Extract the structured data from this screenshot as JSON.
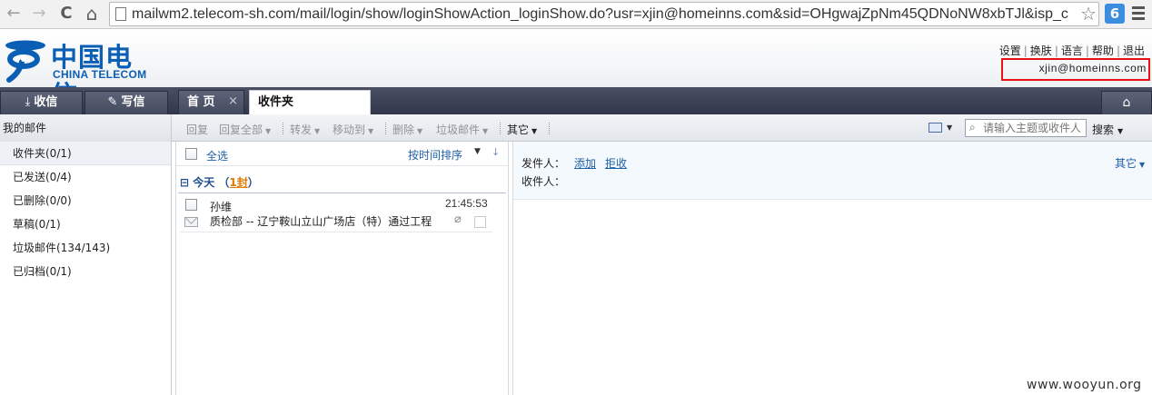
{
  "browser": {
    "back_icon": "←",
    "forward_icon": "→",
    "reload_icon": "C",
    "home_icon": "⌂",
    "url": "mailwm2.telecom-sh.com/mail/login/show/loginShowAction_loginShow.do?usr=xjin@homeinns.com&sid=OHgwajZpNm45QDNoNW8xbTJl&isp_c",
    "bookmark_icon": "☆",
    "extension_label": "6"
  },
  "header": {
    "logo_cn": "中国电信",
    "logo_en": "CHINA TELECOM",
    "links": [
      "设置",
      "换肤",
      "语言",
      "帮助",
      "退出"
    ],
    "user_email": "xjin@homeinns.com"
  },
  "tabs": {
    "receive": "收信",
    "compose": "写信",
    "home": "首 页",
    "home_close": "×",
    "inbox": "收件夹"
  },
  "toolbar": {
    "my_mail": "我的邮件",
    "reply": "回复",
    "reply_all": "回复全部",
    "forward": "转发",
    "move_to": "移动到",
    "delete": "删除",
    "junk": "垃圾邮件",
    "other": "其它",
    "search_placeholder": "请输入主题或收件人",
    "search": "搜索"
  },
  "folders": [
    {
      "label": "收件夹(0/1)"
    },
    {
      "label": "已发送(0/4)"
    },
    {
      "label": "已删除(0/0)"
    },
    {
      "label": "草稿(0/1)"
    },
    {
      "label": "垃圾邮件(134/143)"
    },
    {
      "label": "已归档(0/1)"
    }
  ],
  "list": {
    "select_all": "全选",
    "sort": "按时间排序",
    "group_prefix": "⊟ 今天 （",
    "group_count": "1封",
    "group_suffix": "）",
    "mails": [
      {
        "sender": "孙维",
        "time": "21:45:53",
        "subject": "质检部 -- 辽宁鞍山立山广场店（特）通过工程"
      }
    ]
  },
  "reading": {
    "from_label": "发件人：",
    "to_label": "收件人：",
    "add": "添加",
    "reject": "拒收",
    "other": "其它"
  },
  "watermark": "www.wooyun.org",
  "colors": {
    "brand_blue": "#0a5fb4",
    "highlight_red": "#e8111a",
    "tab_dark": "#3a4054",
    "link_blue": "#1f5fa8"
  }
}
